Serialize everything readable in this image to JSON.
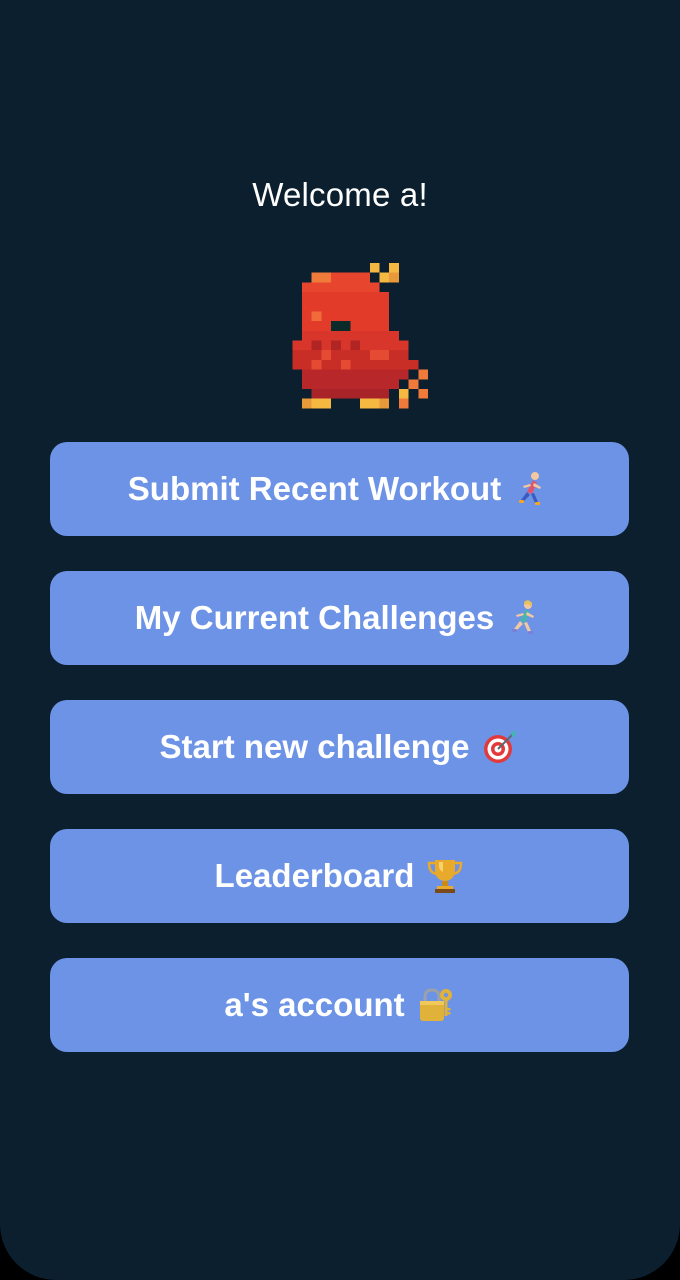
{
  "welcome": {
    "text": "Welcome a!"
  },
  "mascot": {
    "icon": "pixel-red-bird"
  },
  "menu": [
    {
      "label": "Submit Recent Workout",
      "icon": "runner-icon"
    },
    {
      "label": "My Current Challenges",
      "icon": "runner-woman-icon"
    },
    {
      "label": "Start new challenge",
      "icon": "dart-target-icon"
    },
    {
      "label": "Leaderboard",
      "icon": "trophy-icon"
    },
    {
      "label": "a's account",
      "icon": "lock-key-icon"
    }
  ],
  "colors": {
    "background": "#0b1f2e",
    "button": "#6d93e6",
    "text": "#ffffff"
  }
}
